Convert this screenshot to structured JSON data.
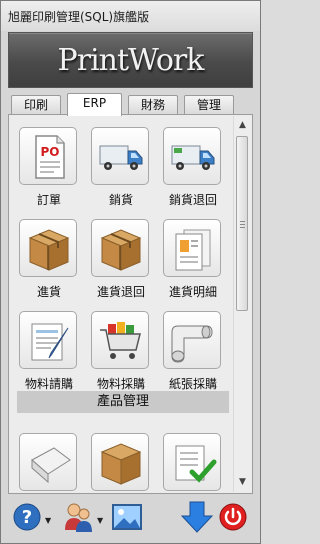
{
  "window": {
    "title": "旭麗印刷管理(SQL)旗艦版"
  },
  "banner": {
    "logo_text": "PrintWork"
  },
  "tabs": [
    {
      "label": "印刷",
      "active": false
    },
    {
      "label": "ERP",
      "active": true
    },
    {
      "label": "財務",
      "active": false
    },
    {
      "label": "管理",
      "active": false
    }
  ],
  "erp": {
    "items": [
      {
        "label": "訂單",
        "icon": "po-document-icon"
      },
      {
        "label": "銷貨",
        "icon": "delivery-truck-icon"
      },
      {
        "label": "銷貨退回",
        "icon": "return-truck-icon"
      },
      {
        "label": "進貨",
        "icon": "box-icon"
      },
      {
        "label": "進貨退回",
        "icon": "box-icon"
      },
      {
        "label": "進貨明細",
        "icon": "report-icon"
      },
      {
        "label": "物料請購",
        "icon": "form-edit-icon"
      },
      {
        "label": "物料採購",
        "icon": "shopping-cart-icon"
      },
      {
        "label": "紙張採購",
        "icon": "paper-roll-icon"
      }
    ],
    "section_title": "產品管理",
    "section_items": [
      {
        "icon": "paper-roll-icon"
      },
      {
        "icon": "box-icon"
      },
      {
        "icon": "checklist-icon"
      }
    ]
  },
  "bottombar": {
    "help_icon": "help-icon",
    "users_icon": "users-icon",
    "image_icon": "picture-icon",
    "download_icon": "download-arrow-icon",
    "power_icon": "power-icon"
  },
  "colors": {
    "banner": "#555555",
    "power": "#e02020",
    "arrow": "#2a7fe0"
  }
}
